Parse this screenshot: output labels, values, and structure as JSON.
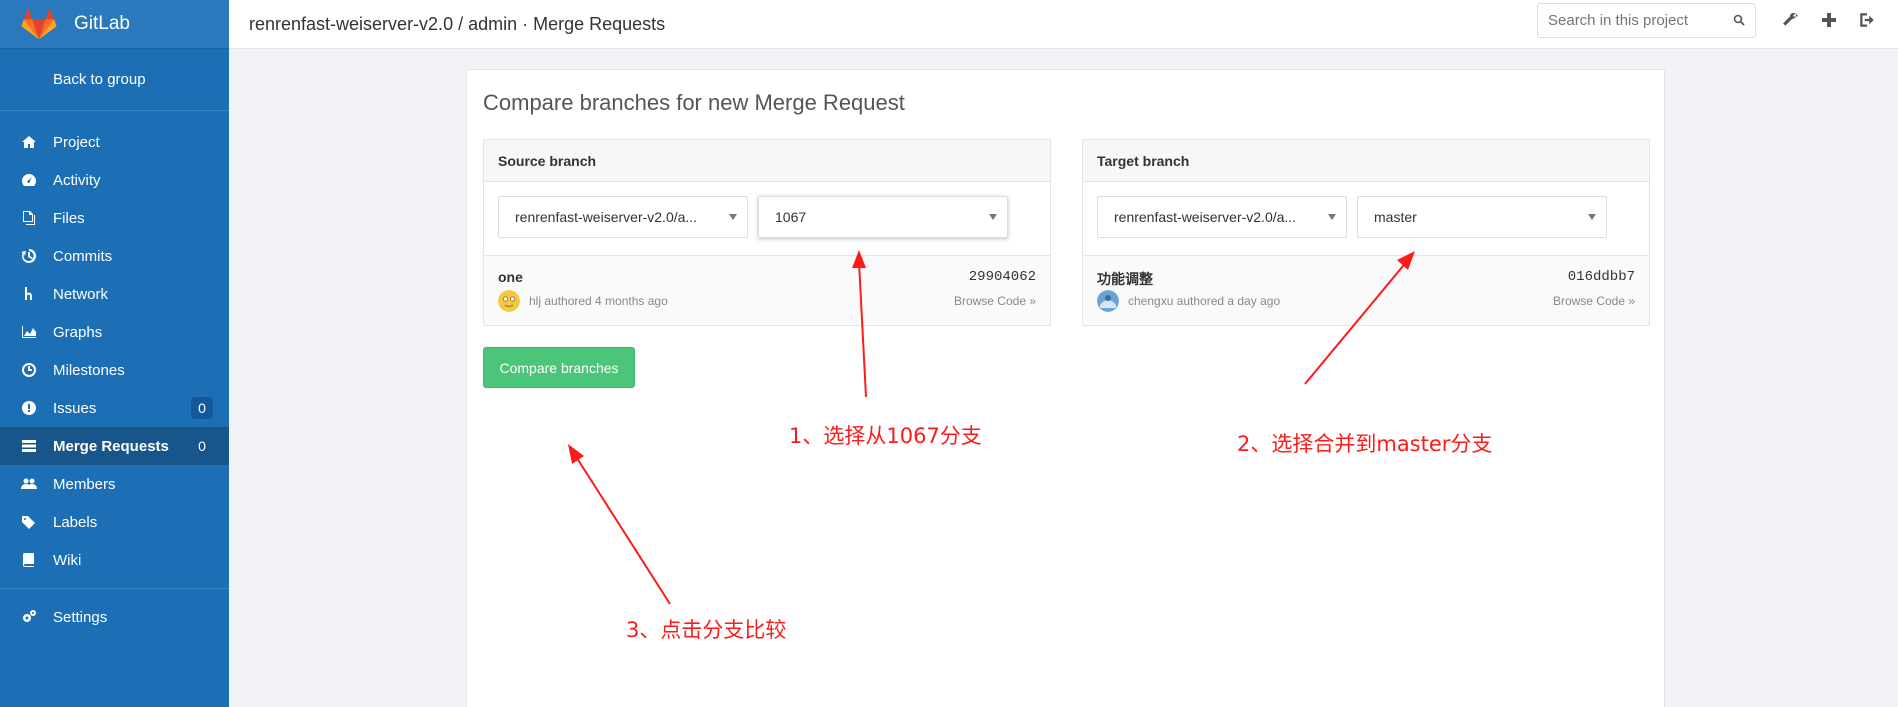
{
  "app": {
    "name": "GitLab"
  },
  "sidebar": {
    "back_label": "Back to group",
    "items": [
      {
        "label": "Project",
        "icon": "home-icon"
      },
      {
        "label": "Activity",
        "icon": "dashboard-icon"
      },
      {
        "label": "Files",
        "icon": "files-icon"
      },
      {
        "label": "Commits",
        "icon": "history-icon"
      },
      {
        "label": "Network",
        "icon": "code-fork-icon"
      },
      {
        "label": "Graphs",
        "icon": "area-chart-icon"
      },
      {
        "label": "Milestones",
        "icon": "clock-icon"
      },
      {
        "label": "Issues",
        "icon": "exclamation-circle-icon",
        "count": "0"
      },
      {
        "label": "Merge Requests",
        "icon": "tasks-icon",
        "count": "0",
        "active": true
      },
      {
        "label": "Members",
        "icon": "users-icon"
      },
      {
        "label": "Labels",
        "icon": "tags-icon"
      },
      {
        "label": "Wiki",
        "icon": "book-icon"
      }
    ],
    "settings_label": "Settings"
  },
  "header": {
    "breadcrumb": "renrenfast-weiserver-v2.0 / admin · Merge Requests",
    "search_placeholder": "Search in this project"
  },
  "main": {
    "title": "Compare branches for new Merge Request",
    "source": {
      "heading": "Source branch",
      "project": "renrenfast-weiserver-v2.0/a...",
      "branch": "1067",
      "commit_message": "one",
      "commit_sha": "29904062",
      "author_meta": "hlj authored 4 months ago",
      "browse": "Browse Code »"
    },
    "target": {
      "heading": "Target branch",
      "project": "renrenfast-weiserver-v2.0/a...",
      "branch": "master",
      "commit_message": "功能调整",
      "commit_sha": "016ddbb7",
      "author_meta": "chengxu authored a day ago",
      "browse": "Browse Code »"
    },
    "compare_button": "Compare branches"
  },
  "annotations": {
    "step1": "1、选择从1067分支",
    "step2": "2、选择合并到master分支",
    "step3": "3、点击分支比较",
    "color": "#ff1a1a"
  },
  "colors": {
    "sidebar": "#1c6fb4",
    "sidebar_active": "#17558a",
    "button_green": "#4bc57a"
  }
}
